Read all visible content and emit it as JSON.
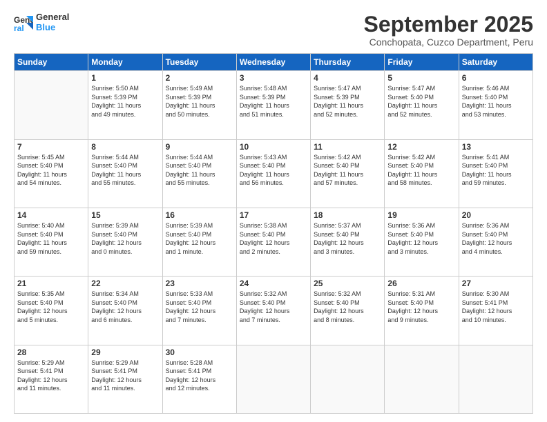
{
  "logo": {
    "general": "General",
    "blue": "Blue"
  },
  "header": {
    "month_title": "September 2025",
    "subtitle": "Conchopata, Cuzco Department, Peru"
  },
  "weekdays": [
    "Sunday",
    "Monday",
    "Tuesday",
    "Wednesday",
    "Thursday",
    "Friday",
    "Saturday"
  ],
  "weeks": [
    [
      {
        "day": "",
        "info": ""
      },
      {
        "day": "1",
        "info": "Sunrise: 5:50 AM\nSunset: 5:39 PM\nDaylight: 11 hours\nand 49 minutes."
      },
      {
        "day": "2",
        "info": "Sunrise: 5:49 AM\nSunset: 5:39 PM\nDaylight: 11 hours\nand 50 minutes."
      },
      {
        "day": "3",
        "info": "Sunrise: 5:48 AM\nSunset: 5:39 PM\nDaylight: 11 hours\nand 51 minutes."
      },
      {
        "day": "4",
        "info": "Sunrise: 5:47 AM\nSunset: 5:39 PM\nDaylight: 11 hours\nand 52 minutes."
      },
      {
        "day": "5",
        "info": "Sunrise: 5:47 AM\nSunset: 5:40 PM\nDaylight: 11 hours\nand 52 minutes."
      },
      {
        "day": "6",
        "info": "Sunrise: 5:46 AM\nSunset: 5:40 PM\nDaylight: 11 hours\nand 53 minutes."
      }
    ],
    [
      {
        "day": "7",
        "info": "Sunrise: 5:45 AM\nSunset: 5:40 PM\nDaylight: 11 hours\nand 54 minutes."
      },
      {
        "day": "8",
        "info": "Sunrise: 5:44 AM\nSunset: 5:40 PM\nDaylight: 11 hours\nand 55 minutes."
      },
      {
        "day": "9",
        "info": "Sunrise: 5:44 AM\nSunset: 5:40 PM\nDaylight: 11 hours\nand 55 minutes."
      },
      {
        "day": "10",
        "info": "Sunrise: 5:43 AM\nSunset: 5:40 PM\nDaylight: 11 hours\nand 56 minutes."
      },
      {
        "day": "11",
        "info": "Sunrise: 5:42 AM\nSunset: 5:40 PM\nDaylight: 11 hours\nand 57 minutes."
      },
      {
        "day": "12",
        "info": "Sunrise: 5:42 AM\nSunset: 5:40 PM\nDaylight: 11 hours\nand 58 minutes."
      },
      {
        "day": "13",
        "info": "Sunrise: 5:41 AM\nSunset: 5:40 PM\nDaylight: 11 hours\nand 59 minutes."
      }
    ],
    [
      {
        "day": "14",
        "info": "Sunrise: 5:40 AM\nSunset: 5:40 PM\nDaylight: 11 hours\nand 59 minutes."
      },
      {
        "day": "15",
        "info": "Sunrise: 5:39 AM\nSunset: 5:40 PM\nDaylight: 12 hours\nand 0 minutes."
      },
      {
        "day": "16",
        "info": "Sunrise: 5:39 AM\nSunset: 5:40 PM\nDaylight: 12 hours\nand 1 minute."
      },
      {
        "day": "17",
        "info": "Sunrise: 5:38 AM\nSunset: 5:40 PM\nDaylight: 12 hours\nand 2 minutes."
      },
      {
        "day": "18",
        "info": "Sunrise: 5:37 AM\nSunset: 5:40 PM\nDaylight: 12 hours\nand 3 minutes."
      },
      {
        "day": "19",
        "info": "Sunrise: 5:36 AM\nSunset: 5:40 PM\nDaylight: 12 hours\nand 3 minutes."
      },
      {
        "day": "20",
        "info": "Sunrise: 5:36 AM\nSunset: 5:40 PM\nDaylight: 12 hours\nand 4 minutes."
      }
    ],
    [
      {
        "day": "21",
        "info": "Sunrise: 5:35 AM\nSunset: 5:40 PM\nDaylight: 12 hours\nand 5 minutes."
      },
      {
        "day": "22",
        "info": "Sunrise: 5:34 AM\nSunset: 5:40 PM\nDaylight: 12 hours\nand 6 minutes."
      },
      {
        "day": "23",
        "info": "Sunrise: 5:33 AM\nSunset: 5:40 PM\nDaylight: 12 hours\nand 7 minutes."
      },
      {
        "day": "24",
        "info": "Sunrise: 5:32 AM\nSunset: 5:40 PM\nDaylight: 12 hours\nand 7 minutes."
      },
      {
        "day": "25",
        "info": "Sunrise: 5:32 AM\nSunset: 5:40 PM\nDaylight: 12 hours\nand 8 minutes."
      },
      {
        "day": "26",
        "info": "Sunrise: 5:31 AM\nSunset: 5:40 PM\nDaylight: 12 hours\nand 9 minutes."
      },
      {
        "day": "27",
        "info": "Sunrise: 5:30 AM\nSunset: 5:41 PM\nDaylight: 12 hours\nand 10 minutes."
      }
    ],
    [
      {
        "day": "28",
        "info": "Sunrise: 5:29 AM\nSunset: 5:41 PM\nDaylight: 12 hours\nand 11 minutes."
      },
      {
        "day": "29",
        "info": "Sunrise: 5:29 AM\nSunset: 5:41 PM\nDaylight: 12 hours\nand 11 minutes."
      },
      {
        "day": "30",
        "info": "Sunrise: 5:28 AM\nSunset: 5:41 PM\nDaylight: 12 hours\nand 12 minutes."
      },
      {
        "day": "",
        "info": ""
      },
      {
        "day": "",
        "info": ""
      },
      {
        "day": "",
        "info": ""
      },
      {
        "day": "",
        "info": ""
      }
    ]
  ]
}
